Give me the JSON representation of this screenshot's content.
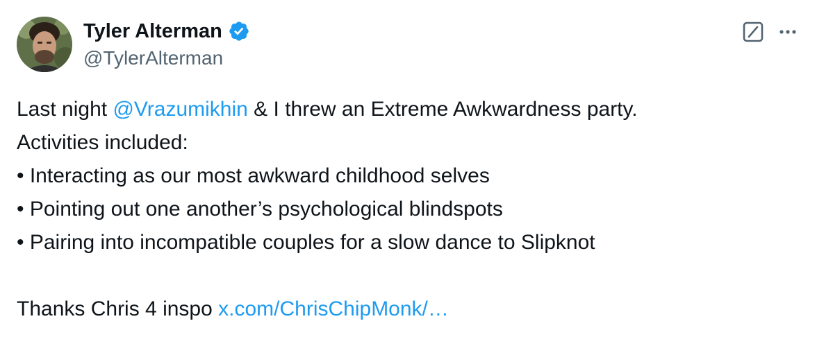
{
  "author": {
    "display_name": "Tyler Alterman",
    "handle": "@TylerAlterman",
    "verified": true,
    "avatar_icon": "avatar-photo"
  },
  "actions": {
    "grok_icon": "grok-slash-icon",
    "more_icon": "more-dots-icon"
  },
  "tweet": {
    "line1_before": "Last night ",
    "mention": "@Vrazumikhin",
    "line1_after": " & I threw an Extreme Awkwardness party.",
    "line2": "Activities included:",
    "bullets": [
      "• Interacting as our most awkward childhood selves",
      "• Pointing out one another’s psychological blindspots",
      "• Pairing into incompatible couples for a slow dance to Slipknot"
    ],
    "thanks_text": "Thanks Chris 4 inspo ",
    "thanks_link": "x.com/ChrisChipMonk/…"
  },
  "colors": {
    "text": "#0f1419",
    "secondary": "#536471",
    "link": "#1d9bf0",
    "verified": "#1d9bf0"
  }
}
